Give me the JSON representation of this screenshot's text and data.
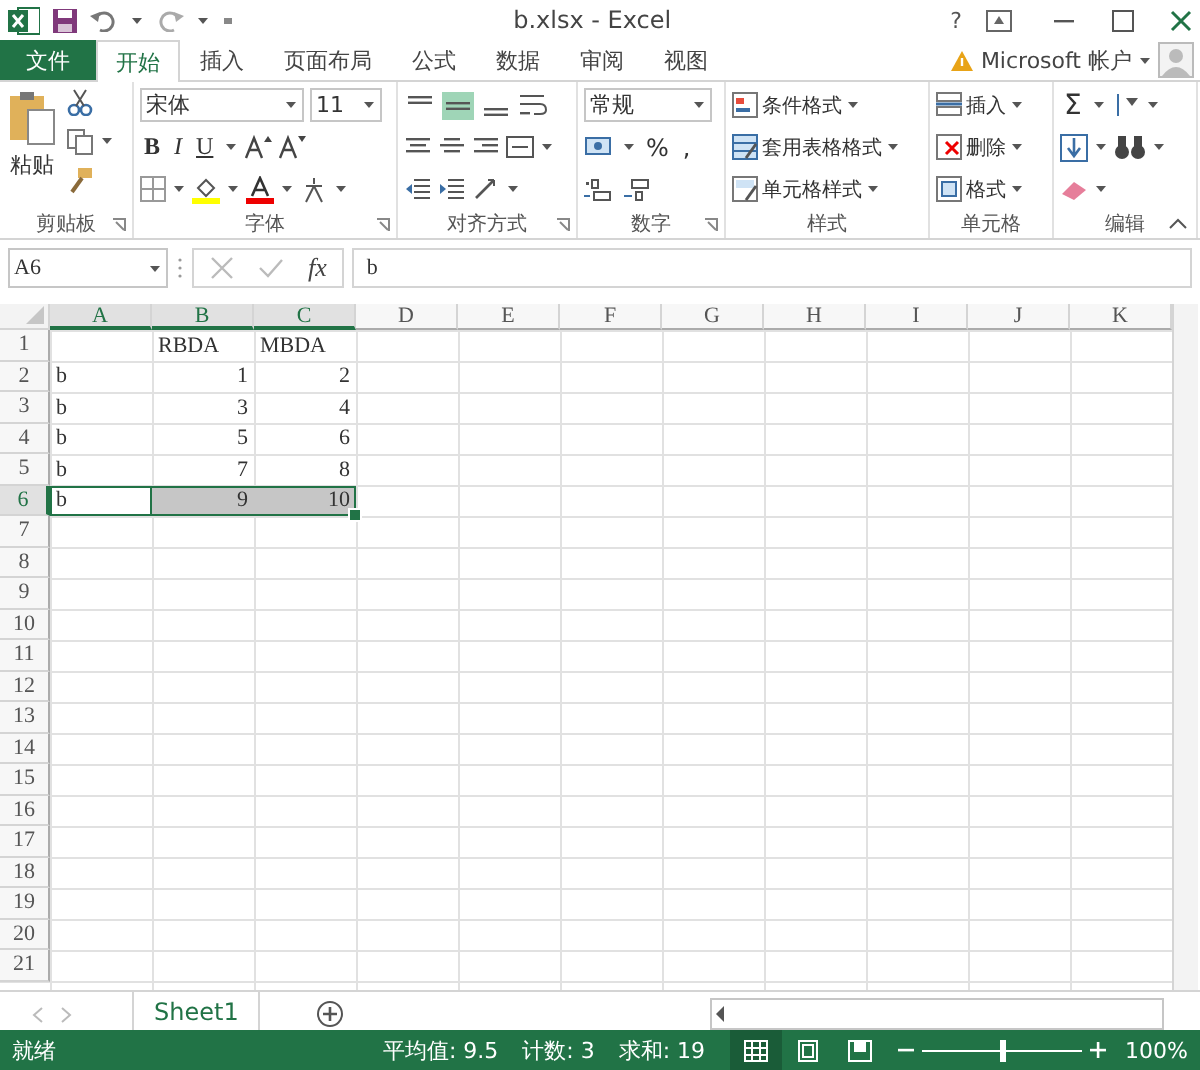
{
  "window": {
    "title": "b.xlsx - Excel",
    "help": "?"
  },
  "tabs": [
    {
      "label": "文件",
      "kind": "file",
      "selected": false
    },
    {
      "label": "开始",
      "kind": "tab",
      "selected": true
    },
    {
      "label": "插入",
      "kind": "tab",
      "selected": false
    },
    {
      "label": "页面布局",
      "kind": "tab",
      "selected": false
    },
    {
      "label": "公式",
      "kind": "tab",
      "selected": false
    },
    {
      "label": "数据",
      "kind": "tab",
      "selected": false
    },
    {
      "label": "审阅",
      "kind": "tab",
      "selected": false
    },
    {
      "label": "视图",
      "kind": "tab",
      "selected": false
    }
  ],
  "account": "Microsoft 帐户",
  "ribbon": {
    "groups": [
      {
        "kind": "clipboard",
        "label": "剪贴板",
        "launcher": true,
        "paste": "粘贴"
      },
      {
        "kind": "font",
        "label": "字体",
        "launcher": true,
        "font": "宋体",
        "size": "11",
        "styles": [
          "B",
          "I",
          "U"
        ]
      },
      {
        "kind": "alignment",
        "label": "对齐方式",
        "launcher": true,
        "vertical": [
          {
            "selected": false
          },
          {
            "selected": true
          },
          {
            "selected": false
          }
        ]
      },
      {
        "kind": "number",
        "label": "数字",
        "launcher": true,
        "format": "常规",
        "symbols": [
          "%",
          ","
        ]
      },
      {
        "kind": "styles",
        "label": "样式",
        "launcher": false,
        "buttons": [
          "条件格式",
          "套用表格格式",
          "单元格样式"
        ]
      },
      {
        "kind": "cells",
        "label": "单元格",
        "launcher": false,
        "buttons": [
          "插入",
          "删除",
          "格式"
        ]
      },
      {
        "kind": "editing",
        "label": "编辑",
        "launcher": false,
        "sum": "Σ"
      }
    ]
  },
  "formula_bar": {
    "name_box": "A6",
    "fx": "fx",
    "value": "b"
  },
  "sheet": {
    "columns": [
      {
        "label": "A",
        "selected": true
      },
      {
        "label": "B",
        "selected": true
      },
      {
        "label": "C",
        "selected": true
      },
      {
        "label": "D",
        "selected": false
      },
      {
        "label": "E",
        "selected": false
      },
      {
        "label": "F",
        "selected": false
      },
      {
        "label": "G",
        "selected": false
      },
      {
        "label": "H",
        "selected": false
      },
      {
        "label": "I",
        "selected": false
      },
      {
        "label": "J",
        "selected": false
      },
      {
        "label": "K",
        "selected": false
      }
    ],
    "rows": [
      {
        "label": "1",
        "selected": false,
        "cells": [
          null,
          {
            "value": "RBDA",
            "kind": "text",
            "selected": false,
            "active": false
          },
          {
            "value": "MBDA",
            "kind": "text",
            "selected": false,
            "active": false
          }
        ]
      },
      {
        "label": "2",
        "selected": false,
        "cells": [
          {
            "value": "b",
            "kind": "text",
            "selected": false,
            "active": false
          },
          {
            "value": "1",
            "kind": "number",
            "selected": false,
            "active": false
          },
          {
            "value": "2",
            "kind": "number",
            "selected": false,
            "active": false
          }
        ]
      },
      {
        "label": "3",
        "selected": false,
        "cells": [
          {
            "value": "b",
            "kind": "text",
            "selected": false,
            "active": false
          },
          {
            "value": "3",
            "kind": "number",
            "selected": false,
            "active": false
          },
          {
            "value": "4",
            "kind": "number",
            "selected": false,
            "active": false
          }
        ]
      },
      {
        "label": "4",
        "selected": false,
        "cells": [
          {
            "value": "b",
            "kind": "text",
            "selected": false,
            "active": false
          },
          {
            "value": "5",
            "kind": "number",
            "selected": false,
            "active": false
          },
          {
            "value": "6",
            "kind": "number",
            "selected": false,
            "active": false
          }
        ]
      },
      {
        "label": "5",
        "selected": false,
        "cells": [
          {
            "value": "b",
            "kind": "text",
            "selected": false,
            "active": false
          },
          {
            "value": "7",
            "kind": "number",
            "selected": false,
            "active": false
          },
          {
            "value": "8",
            "kind": "number",
            "selected": false,
            "active": false
          }
        ]
      },
      {
        "label": "6",
        "selected": true,
        "cells": [
          {
            "value": "b",
            "kind": "text",
            "selected": true,
            "active": true
          },
          {
            "value": "9",
            "kind": "number",
            "selected": true,
            "active": false
          },
          {
            "value": "10",
            "kind": "number",
            "selected": true,
            "active": false
          }
        ]
      },
      {
        "label": "7",
        "selected": false
      },
      {
        "label": "8",
        "selected": false
      },
      {
        "label": "9",
        "selected": false
      },
      {
        "label": "10",
        "selected": false
      },
      {
        "label": "11",
        "selected": false
      },
      {
        "label": "12",
        "selected": false
      },
      {
        "label": "13",
        "selected": false
      },
      {
        "label": "14",
        "selected": false
      },
      {
        "label": "15",
        "selected": false
      },
      {
        "label": "16",
        "selected": false
      },
      {
        "label": "17",
        "selected": false
      },
      {
        "label": "18",
        "selected": false
      },
      {
        "label": "19",
        "selected": false
      },
      {
        "label": "20",
        "selected": false
      },
      {
        "label": "21",
        "selected": false
      }
    ]
  },
  "sheet_tabs": [
    {
      "label": "Sheet1",
      "selected": true
    }
  ],
  "status_bar": {
    "status": "就绪",
    "stats": [
      "平均值: 9.5",
      "计数: 3",
      "求和: 19"
    ],
    "views": [
      {
        "selected": true
      },
      {
        "selected": false
      },
      {
        "selected": false
      }
    ],
    "zoom": {
      "level": 0.5,
      "reading": "100%"
    }
  }
}
